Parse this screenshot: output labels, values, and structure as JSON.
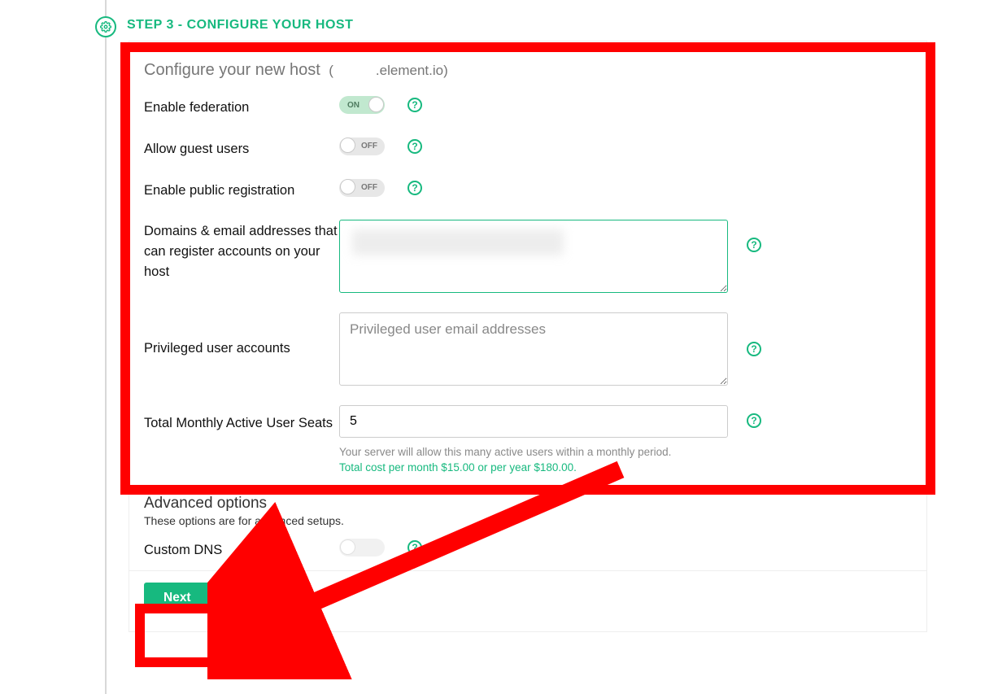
{
  "step": {
    "title": "STEP 3 - CONFIGURE YOUR HOST"
  },
  "header": {
    "title": "Configure your new host",
    "host_suffix": ".element.io)",
    "host_prefix": "("
  },
  "rows": {
    "federation": {
      "label": "Enable federation",
      "on_text": "ON"
    },
    "guest": {
      "label": "Allow guest users",
      "off_text": "OFF"
    },
    "public_reg": {
      "label": "Enable public registration",
      "off_text": "OFF"
    },
    "domains": {
      "label": "Domains & email addresses that can register accounts on your host"
    },
    "privileged": {
      "label": "Privileged user accounts",
      "placeholder": "Privileged user email addresses"
    },
    "seats": {
      "label": "Total Monthly Active User Seats",
      "value": "5",
      "help": "Your server will allow this many active users within a monthly period.",
      "cost": "Total cost per month $15.00 or per year $180.00."
    },
    "custom_dns": {
      "label": "Custom DNS"
    }
  },
  "advanced": {
    "title": "Advanced options",
    "subtitle": "These options are for advanced setups."
  },
  "footer": {
    "next": "Next"
  }
}
